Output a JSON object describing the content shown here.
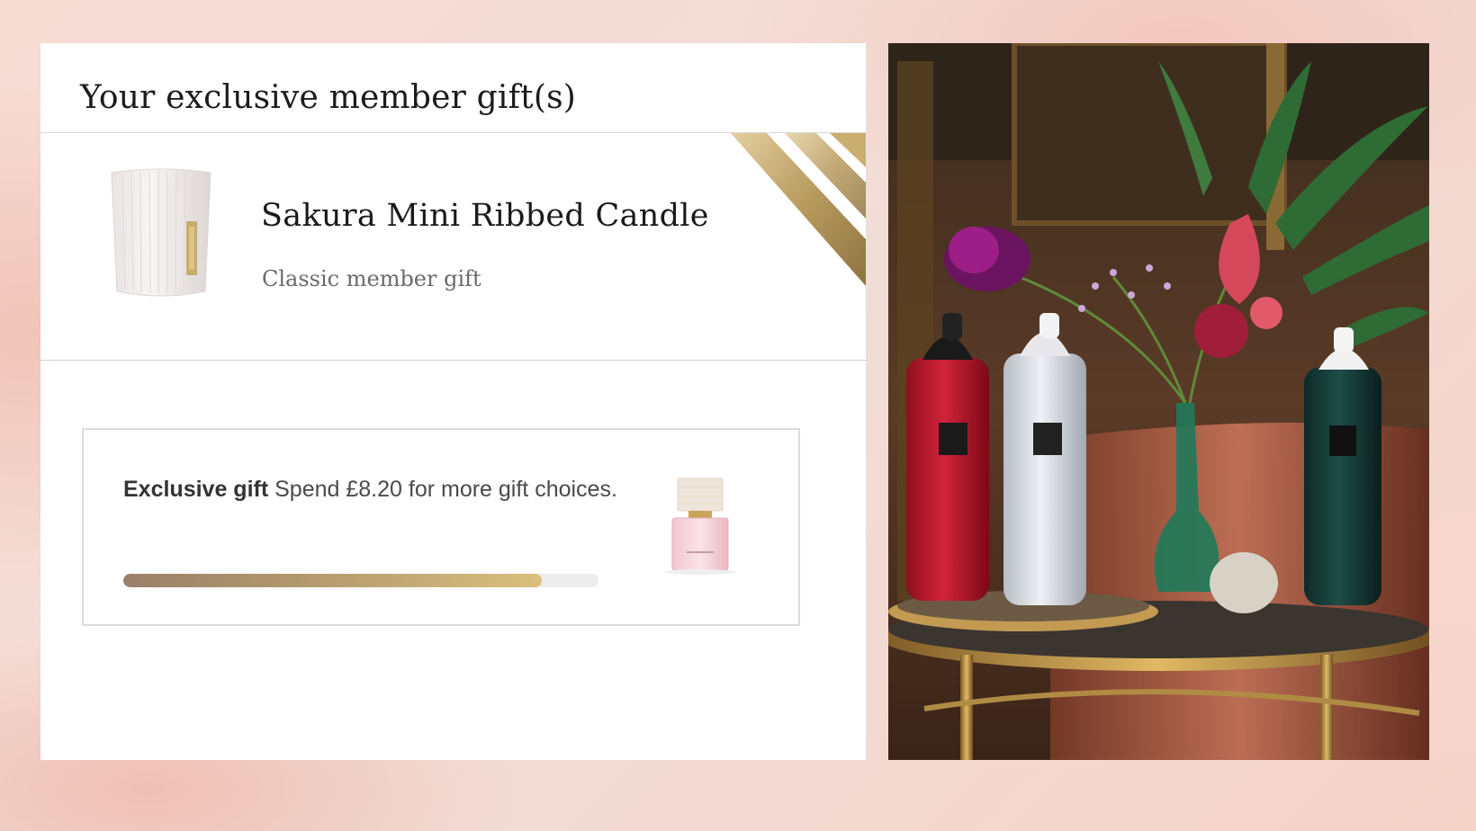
{
  "panel": {
    "title": "Your exclusive member gift(s)"
  },
  "gift": {
    "name": "Sakura Mini Ribbed Candle",
    "subtitle": "Classic member gift",
    "image_icon": "candle-product-image"
  },
  "progress": {
    "label_bold": "Exclusive gift",
    "label_text": "Spend £8.20 for more gift choices.",
    "fraction": 0.88,
    "image_icon": "perfume-product-image"
  },
  "colors": {
    "accent_gold": "#d9c07d",
    "accent_brown": "#9b7f6a"
  }
}
